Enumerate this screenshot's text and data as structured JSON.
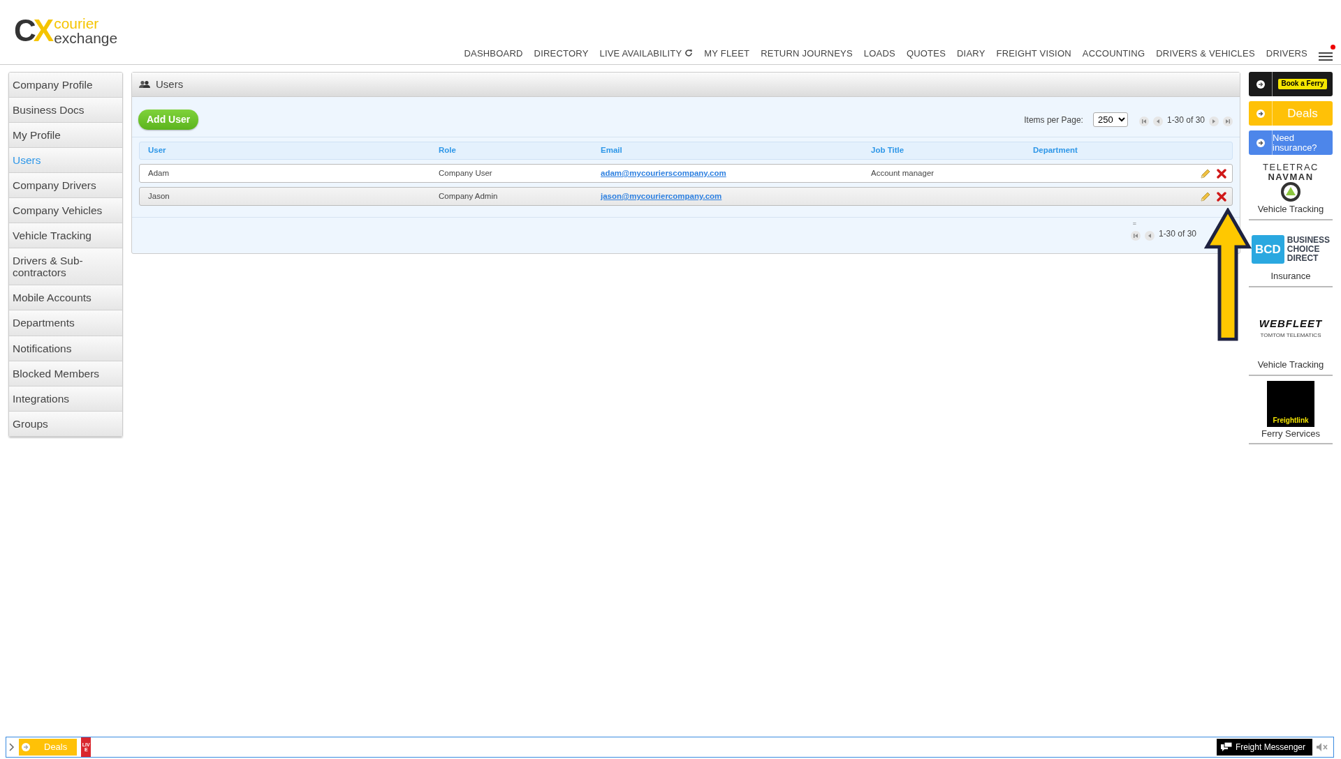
{
  "logo": {
    "mark": "CX",
    "line1": "courier",
    "line2": "exchange"
  },
  "nav": [
    {
      "label": "DASHBOARD",
      "kind": "plain"
    },
    {
      "label": "DIRECTORY",
      "kind": "plain"
    },
    {
      "label": "LIVE AVAILABILITY",
      "kind": "refresh"
    },
    {
      "label": "MY FLEET",
      "kind": "plain"
    },
    {
      "label": "RETURN JOURNEYS",
      "kind": "plain"
    },
    {
      "label": "LOADS",
      "kind": "plain"
    },
    {
      "label": "QUOTES",
      "kind": "plain"
    },
    {
      "label": "DIARY",
      "kind": "plain"
    },
    {
      "label": "FREIGHT VISION",
      "kind": "plain"
    },
    {
      "label": "ACCOUNTING",
      "kind": "plain"
    },
    {
      "label": "DRIVERS & VEHICLES",
      "kind": "plain"
    },
    {
      "label": "DRIVERS",
      "kind": "plain"
    }
  ],
  "menu": {
    "notification": true
  },
  "sidebar": {
    "items": [
      {
        "label": "Company Profile",
        "selected": false
      },
      {
        "label": "Business Docs",
        "selected": false
      },
      {
        "label": "My Profile",
        "selected": false
      },
      {
        "label": "Users",
        "selected": true
      },
      {
        "label": "Company Drivers",
        "selected": false
      },
      {
        "label": "Company Vehicles",
        "selected": false
      },
      {
        "label": "Vehicle Tracking",
        "selected": false
      },
      {
        "label": "Drivers & Sub-contractors",
        "selected": false
      },
      {
        "label": "Mobile Accounts",
        "selected": false
      },
      {
        "label": "Departments",
        "selected": false
      },
      {
        "label": "Notifications",
        "selected": false
      },
      {
        "label": "Blocked Members",
        "selected": false
      },
      {
        "label": "Integrations",
        "selected": false
      },
      {
        "label": "Groups",
        "selected": false
      }
    ]
  },
  "panel": {
    "title": "Users",
    "add_button": "Add User",
    "items_per_page_label": "Items per Page:",
    "items_per_page": "250",
    "pager_text": "1-30 of 30",
    "table": {
      "columns": [
        "User",
        "Role",
        "Email",
        "Job Title",
        "Department"
      ],
      "rows": [
        {
          "user": "Adam",
          "role": "Company User",
          "email": "adam@mycourierscompany.com",
          "job_title": "Account manager",
          "department": ""
        },
        {
          "user": "Jason",
          "role": "Company Admin",
          "email": "jason@mycouriercompany.com",
          "job_title": "",
          "department": ""
        }
      ]
    },
    "footer_mark": "=",
    "footer_pager_text": "1-30 of 30"
  },
  "promos": [
    {
      "label": "Book a Ferry",
      "color": "#1a1a1a"
    },
    {
      "label": "Deals",
      "color": "#ffc107"
    },
    {
      "label": "Need insurance?",
      "color": "#4d86ea"
    }
  ],
  "partners": [
    {
      "kind": "teletrac",
      "logo_lines": [
        "TELETRAC",
        "NAVMAN"
      ],
      "caption": "Vehicle Tracking"
    },
    {
      "kind": "bcd",
      "logo_lines": [
        "BCD",
        "BUSINESS",
        "CHOICE",
        "DIRECT"
      ],
      "caption": "Insurance"
    },
    {
      "kind": "webfleet",
      "logo_lines": [
        "WEBFLEET",
        "TOMTOM TELEMATICS"
      ],
      "caption": "Vehicle Tracking"
    },
    {
      "kind": "freightlink",
      "logo_lines": [
        "Freightlink"
      ],
      "caption": "Ferry Services"
    }
  ],
  "bottom_bar": {
    "deals": "Deals",
    "live": "LIVE",
    "messenger": "Freight Messenger",
    "muted": true
  }
}
